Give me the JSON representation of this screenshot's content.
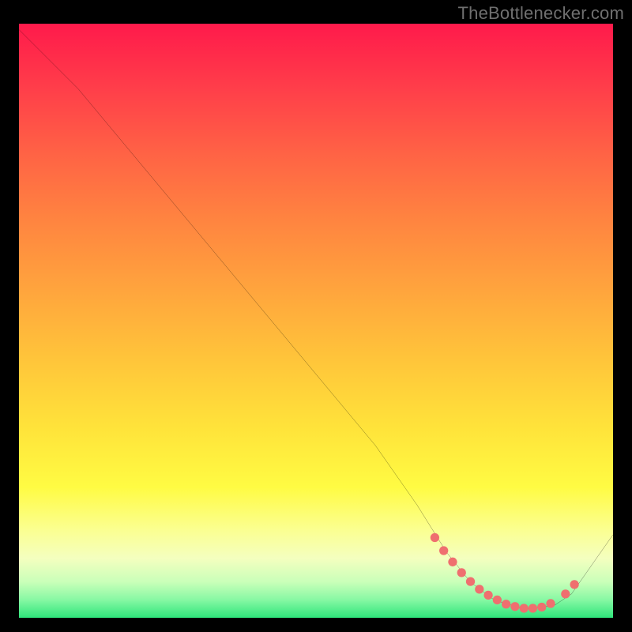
{
  "attribution": "TheBottlenecker.com",
  "chart_data": {
    "type": "line",
    "title": "",
    "xlabel": "",
    "ylabel": "",
    "xlim": [
      0,
      100
    ],
    "ylim": [
      0,
      100
    ],
    "series": [
      {
        "name": "curve",
        "x": [
          0,
          6,
          10,
          20,
          30,
          40,
          50,
          60,
          67,
          72,
          76,
          80,
          85,
          90,
          93,
          100
        ],
        "y": [
          99,
          93,
          89,
          77,
          65,
          53,
          41,
          29,
          19,
          11,
          6,
          3,
          1.5,
          2,
          4,
          14
        ]
      }
    ],
    "markers": {
      "name": "highlight-band",
      "color": "#ef6f6f",
      "points": [
        {
          "x": 70,
          "y": 13.5
        },
        {
          "x": 71.5,
          "y": 11.3
        },
        {
          "x": 73,
          "y": 9.4
        },
        {
          "x": 74.5,
          "y": 7.6
        },
        {
          "x": 76,
          "y": 6.1
        },
        {
          "x": 77.5,
          "y": 4.8
        },
        {
          "x": 79,
          "y": 3.8
        },
        {
          "x": 80.5,
          "y": 3.0
        },
        {
          "x": 82,
          "y": 2.3
        },
        {
          "x": 83.5,
          "y": 1.9
        },
        {
          "x": 85,
          "y": 1.6
        },
        {
          "x": 86.5,
          "y": 1.6
        },
        {
          "x": 88,
          "y": 1.8
        },
        {
          "x": 89.5,
          "y": 2.4
        },
        {
          "x": 92,
          "y": 4.0
        },
        {
          "x": 93.5,
          "y": 5.6
        }
      ]
    }
  },
  "colors": {
    "curve": "#000000",
    "marker": "#ef6f6f",
    "attribution": "#6f6f6f"
  }
}
